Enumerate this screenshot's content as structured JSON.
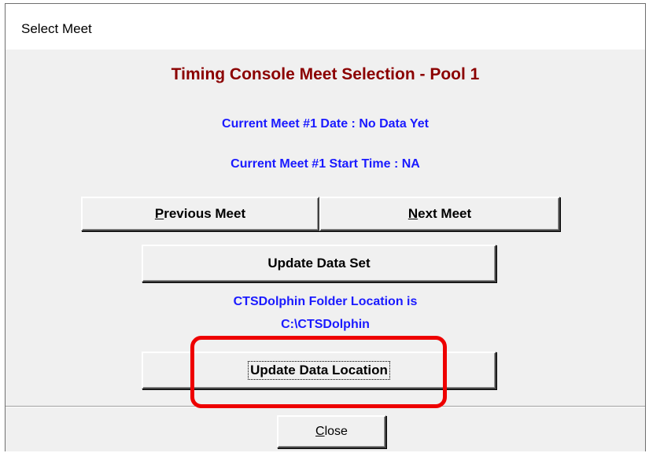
{
  "window": {
    "title": "Select Meet"
  },
  "dialog": {
    "heading": "Timing Console Meet Selection - Pool 1",
    "current_meet_date": "Current Meet #1 Date : No Data Yet",
    "current_meet_start_time": "Current Meet #1 Start Time : NA",
    "folder_location_line1": "CTSDolphin Folder Location is",
    "folder_location_line2": "C:\\CTSDolphin"
  },
  "buttons": {
    "previous_meet": {
      "mnemonic": "P",
      "rest": "revious Meet"
    },
    "next_meet": {
      "mnemonic": "N",
      "rest": "ext Meet"
    },
    "update_data_set": "Update Data Set",
    "update_data_location": "Update Data Location",
    "close": {
      "mnemonic": "C",
      "rest": "lose"
    }
  },
  "annotation": {
    "highlight_color": "#ee0000",
    "highlight_target": "update-data-location-button"
  }
}
